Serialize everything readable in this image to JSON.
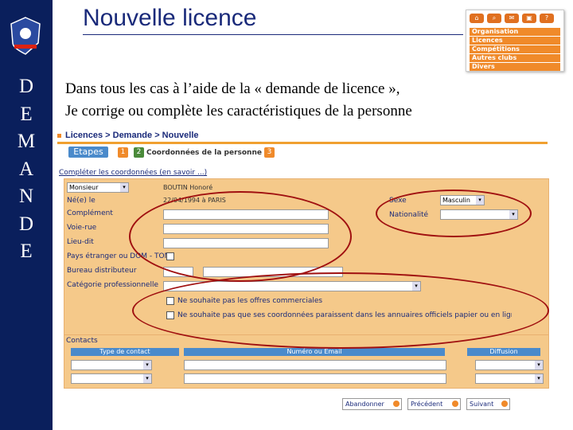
{
  "slide": {
    "title": "Nouvelle licence",
    "vertical_word": [
      "D",
      "E",
      "M",
      "A",
      "N",
      "D",
      "E"
    ],
    "body_line1": "Dans tous les cas à l’aide de la « demande de licence »,",
    "body_line2": "Je corrige ou complète les caractéristiques de la personne"
  },
  "menu": {
    "items": [
      "Organisation",
      "Licences",
      "Compétitions",
      "Autres clubs",
      "Divers"
    ],
    "icons": [
      "home-icon",
      "search-icon",
      "mail-icon",
      "print-icon",
      "help-icon"
    ]
  },
  "screenshot": {
    "breadcrumb": "Licences > Demande > Nouvelle",
    "etapes_label": "Etapes",
    "step1": "1",
    "step2": "2",
    "step2_label": "Coordonnées de la personne",
    "step3": "3",
    "complete_link": "Compléter les coordonnées (en savoir ...)",
    "civility_value": "Monsieur",
    "name_value": "BOUTIN Honoré",
    "born_label": "Né(e) le",
    "born_value": "22/04/1994  à  PARIS",
    "complement_label": "Complément",
    "voie_label": "Voie-rue",
    "lieudit_label": "Lieu-dit",
    "pays_label": "Pays étranger ou DOM - TOM",
    "bureau_label": "Bureau distributeur",
    "categorie_label": "Catégorie professionnelle",
    "sexe_label": "Sexe",
    "sexe_value": "Masculin",
    "nationalite_label": "Nationalité",
    "opt_out1": "Ne souhaite pas les offres commerciales",
    "opt_out2": "Ne souhaite pas que ses coordonnées paraissent dans les annuaires officiels papier ou en ligne",
    "contacts_title": "Contacts",
    "col_type": "Type de contact",
    "col_numero": "Numéro ou Email",
    "col_diffusion": "Diffusion",
    "btn_abandonner": "Abandonner",
    "btn_precedent": "Précédent",
    "btn_suivant": "Suivant"
  },
  "colors": {
    "sidebar": "#0a1f5c",
    "accent_orange": "#f08a2a",
    "panel": "#f5c98a",
    "annotation_red": "#a01010"
  }
}
